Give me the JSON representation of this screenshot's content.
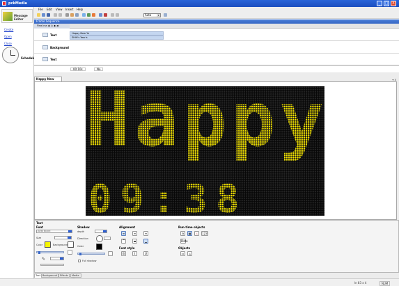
{
  "window": {
    "title": "pckMedia",
    "buttons": [
      "_",
      "□",
      "X"
    ]
  },
  "left_panel": {
    "message_editor": "Message Editor",
    "links": [
      "Create",
      "Open",
      "Close"
    ],
    "schedule": "Schedule"
  },
  "menu": [
    "File",
    "Edit",
    "View",
    "Insert",
    "Help"
  ],
  "toolbar": {
    "zoom": "Auto"
  },
  "frame_sequence": {
    "title": "Frame Sequence",
    "ruler_tools": "Final.css   ◉   ◎   ◆   ◀",
    "tracks": [
      {
        "label": "Text",
        "frames": [
          "Happy New Ye",
          "SIHH's Year's"
        ]
      },
      {
        "label": "Background",
        "frames": []
      },
      {
        "label": "Text",
        "frames": []
      }
    ],
    "footer": [
      "00:10s",
      "No"
    ]
  },
  "preview": {
    "tab": "Happy New Year",
    "line1": "Happy",
    "line2": "09:38",
    "led_color": "#f0e000",
    "led_bg": "#080808",
    "close_mark": "▾ x"
  },
  "text_properties": {
    "title": "Text",
    "font": {
      "group": "Font",
      "font_name": "Arial Black",
      "size_label": "Size",
      "color_label": "Color",
      "background_label": "Background",
      "text_color": "#f5f500",
      "bg_color": "#ffffff"
    },
    "shadow": {
      "group": "Shadow",
      "depth_label": "depth",
      "direction_label": "Direction",
      "color_label": "Color",
      "color": "#000000",
      "full_shadow": "Full shadow"
    },
    "alignment": {
      "group": "Alignment",
      "font_style": "Font style",
      "style_buttons": [
        "B",
        "I",
        "U"
      ]
    },
    "runtime": {
      "group": "Run-time objects",
      "objects": "Objects",
      "date_btn": "Date"
    }
  },
  "bottom_tabs": [
    "Text",
    "Background",
    "Effects",
    "Media Library"
  ],
  "status": {
    "left": "",
    "right_pos": "ln 83  x 4",
    "right_mode": "NUM"
  }
}
